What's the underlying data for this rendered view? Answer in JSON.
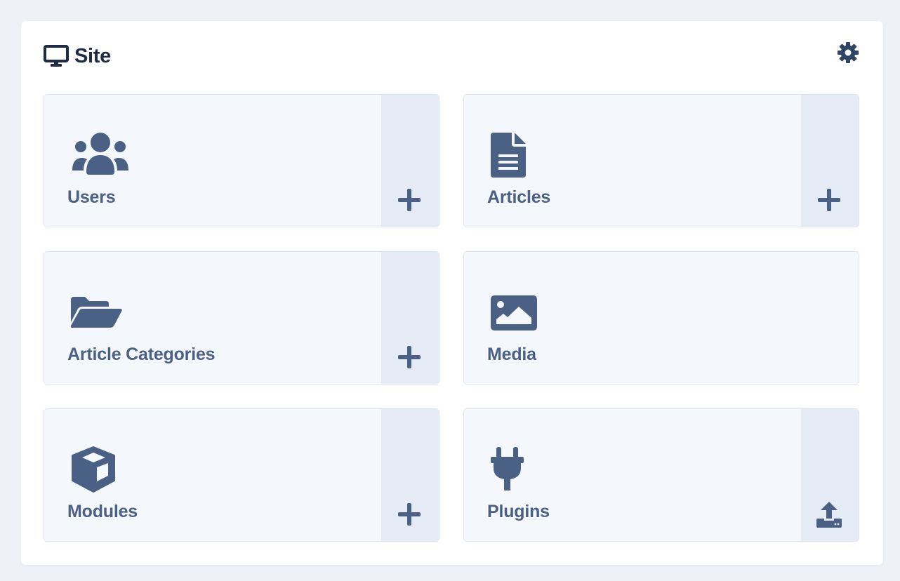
{
  "panel": {
    "title": "Site",
    "title_icon": "desktop-icon",
    "settings_icon": "gear-icon"
  },
  "tiles": [
    {
      "label": "Users",
      "icon": "users-icon",
      "action_icon": "plus-icon"
    },
    {
      "label": "Articles",
      "icon": "file-text-icon",
      "action_icon": "plus-icon"
    },
    {
      "label": "Article Categories",
      "icon": "folder-open-icon",
      "action_icon": "plus-icon"
    },
    {
      "label": "Media",
      "icon": "image-icon",
      "action_icon": null
    },
    {
      "label": "Modules",
      "icon": "cube-icon",
      "action_icon": "plus-icon"
    },
    {
      "label": "Plugins",
      "icon": "plug-icon",
      "action_icon": "upload-icon"
    }
  ],
  "colors": {
    "background": "#eef2f7",
    "panel": "#ffffff",
    "tile": "#f4f7fc",
    "tile_action": "#e4ebf5",
    "icon": "#4a6185",
    "title": "#1e2d45"
  }
}
